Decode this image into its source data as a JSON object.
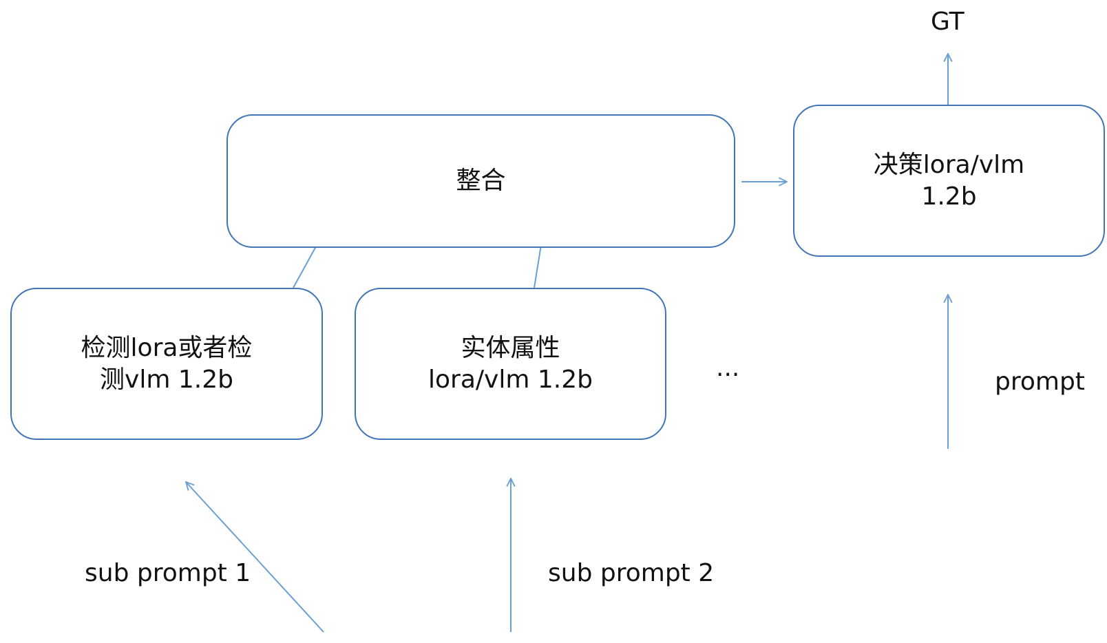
{
  "nodes": {
    "integrate": {
      "lines": [
        "整合"
      ]
    },
    "decision": {
      "lines": [
        "决策lora/vlm",
        "1.2b"
      ]
    },
    "detect": {
      "lines": [
        "检测lora或者检",
        "测vlm 1.2b"
      ]
    },
    "entity": {
      "lines": [
        "实体属性",
        "lora/vlm 1.2b"
      ]
    }
  },
  "labels": {
    "gt": "GT",
    "ellipsis": "...",
    "prompt": "prompt",
    "sub_prompt_1": "sub prompt 1",
    "sub_prompt_2": "sub prompt 2"
  },
  "edges": [
    {
      "from": "sub_prompt_1",
      "to": "detect"
    },
    {
      "from": "sub_prompt_2",
      "to": "entity"
    },
    {
      "from": "detect",
      "to": "integrate"
    },
    {
      "from": "entity",
      "to": "integrate"
    },
    {
      "from": "integrate",
      "to": "decision"
    },
    {
      "from": "prompt",
      "to": "decision"
    },
    {
      "from": "decision",
      "to": "gt"
    }
  ],
  "colors": {
    "box_border": "#3f74b8",
    "arrow": "#6b9fd4"
  }
}
